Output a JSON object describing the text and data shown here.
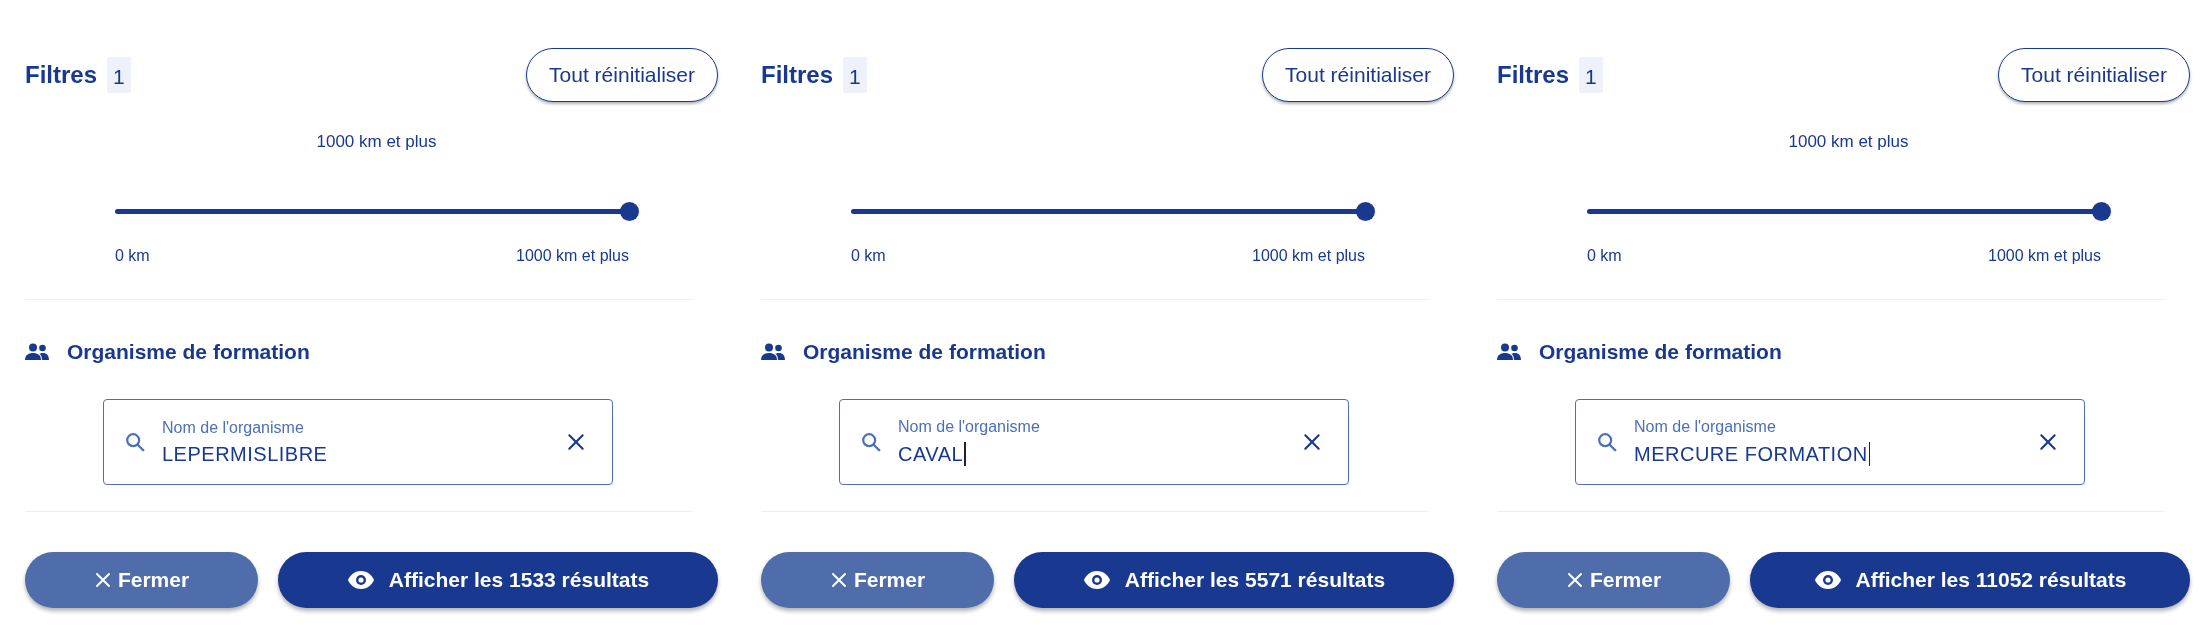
{
  "panels": [
    {
      "title": "Filtres",
      "count": "1",
      "reset_button": "Tout réinitialiser",
      "distance": {
        "value_label": "1000 km et plus",
        "level": 1,
        "min_label": "0 km",
        "max_label": "1000 km et plus"
      },
      "section": {
        "title": "Organisme de formation",
        "field": {
          "label": "Nom de l'organisme",
          "value": "LEPERMISLIBRE",
          "focused": false
        }
      },
      "close_button": "Fermer",
      "submit_button": "Afficher les 1533 résultats"
    },
    {
      "title": "Filtres",
      "count": "1",
      "reset_button": "Tout réinitialiser",
      "distance": {
        "level": 1,
        "min_label": "0 km",
        "max_label": "1000 km et plus"
      },
      "section": {
        "title": "Organisme de formation",
        "field": {
          "label": "Nom de l'organisme",
          "value": "CAVAL",
          "focused": true
        }
      },
      "close_button": "Fermer",
      "submit_button": "Afficher les 5571 résultats"
    },
    {
      "title": "Filtres",
      "count": "1",
      "reset_button": "Tout réinitialiser",
      "distance": {
        "value_label": "1000 km et plus",
        "level": 1,
        "min_label": "0 km",
        "max_label": "1000 km et plus"
      },
      "section": {
        "title": "Organisme de formation",
        "field": {
          "label": "Nom de l'organisme",
          "value": "MERCURE FORMATION",
          "focused": true
        }
      },
      "close_button": "Fermer",
      "submit_button": "Afficher les 11052 résultats"
    }
  ]
}
